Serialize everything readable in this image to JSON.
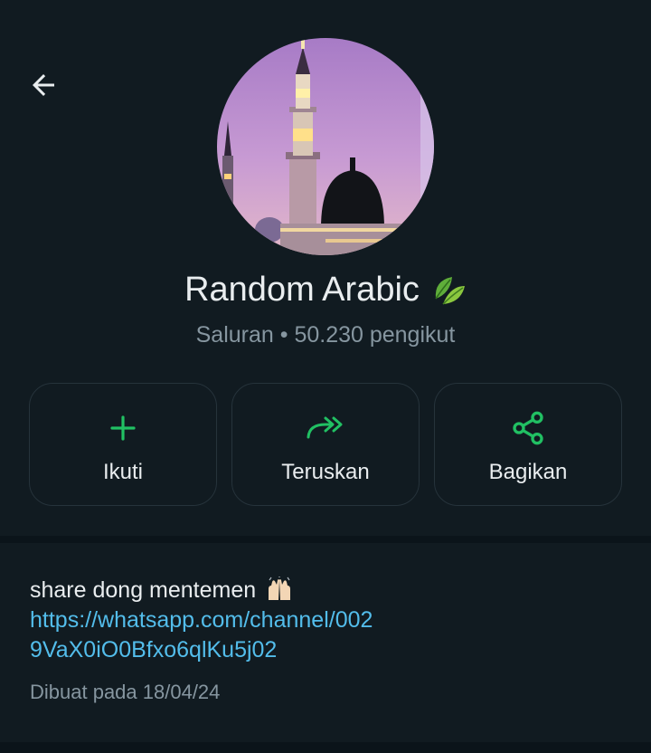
{
  "header": {
    "back_icon": "arrow-left-icon",
    "avatar_alt": "mosque-avatar"
  },
  "channel": {
    "name": "Random Arabic",
    "name_emoji": "leaves-emoji",
    "subtitle": "Saluran • 50.230 pengikut"
  },
  "actions": [
    {
      "label": "Ikuti",
      "icon": "plus-icon"
    },
    {
      "label": "Teruskan",
      "icon": "forward-icon"
    },
    {
      "label": "Bagikan",
      "icon": "share-icon"
    }
  ],
  "description": {
    "text": "share dong mentemen",
    "text_emoji": "raised-hands-emoji",
    "link": "https://whatsapp.com/channel/0029VaX0iO0Bfxo6qlKu5j02",
    "created": "Dibuat pada 18/04/24"
  },
  "colors": {
    "background": "#0b141a",
    "card": "#111b21",
    "accent_green": "#21c063",
    "link_blue": "#53bdeb",
    "muted_text": "#8696a0"
  }
}
